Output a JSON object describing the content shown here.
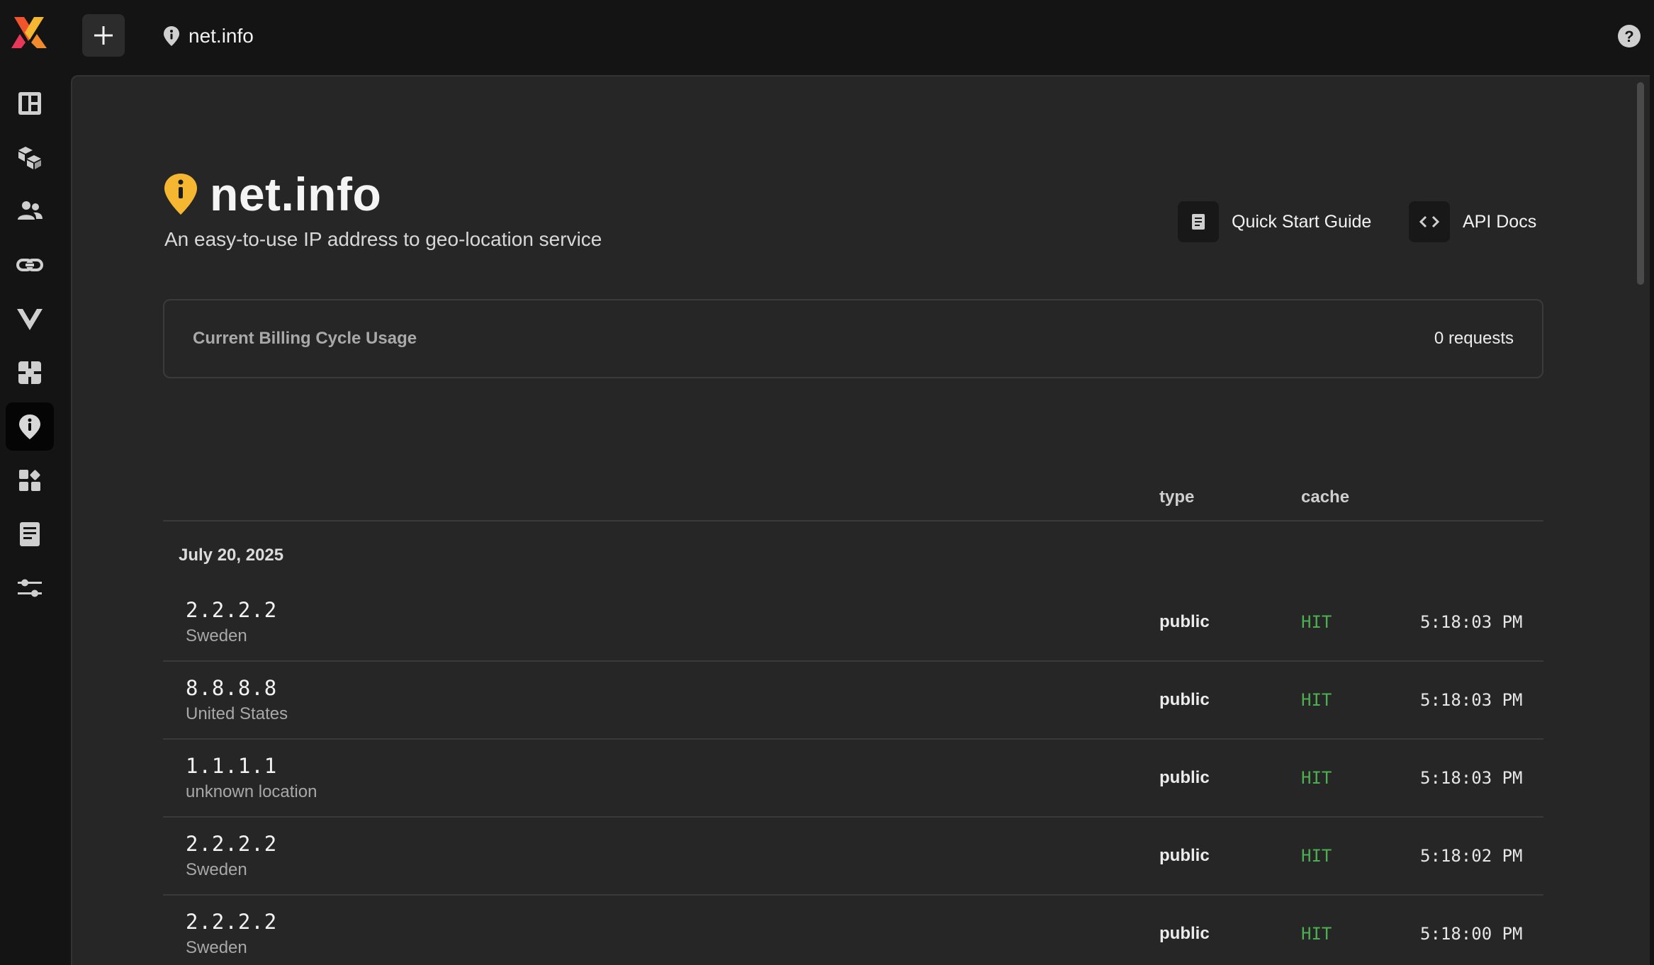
{
  "topbar": {
    "app_logo": "multicolor-logo",
    "new_button_icon": "plus-icon",
    "breadcrumb": {
      "icon": "info-pin-icon",
      "label": "net.info"
    },
    "help_icon": "help-icon"
  },
  "sidebar": {
    "items": [
      {
        "icon": "dashboard-icon",
        "active": false
      },
      {
        "icon": "boxes-icon",
        "active": false
      },
      {
        "icon": "users-icon",
        "active": false
      },
      {
        "icon": "link-icon",
        "active": false
      },
      {
        "icon": "vue-icon",
        "active": false
      },
      {
        "icon": "puzzle-icon",
        "active": false
      },
      {
        "icon": "info-pin-icon",
        "active": true
      },
      {
        "icon": "apps-icon",
        "active": false
      },
      {
        "icon": "document-icon",
        "active": false
      },
      {
        "icon": "sliders-icon",
        "active": false
      }
    ]
  },
  "header": {
    "title": "net.info",
    "subtitle": "An easy-to-use IP address to geo-location service",
    "title_icon_color": "#f5b731",
    "actions": [
      {
        "label": "Quick Start Guide",
        "icon": "document-icon"
      },
      {
        "label": "API Docs",
        "icon": "code-icon"
      }
    ]
  },
  "usage": {
    "label": "Current Billing Cycle Usage",
    "value": "0 requests"
  },
  "table": {
    "columns": {
      "type": "type",
      "cache": "cache"
    },
    "date_group": "July 20, 2025",
    "rows": [
      {
        "ip": "2.2.2.2",
        "location": "Sweden",
        "type": "public",
        "cache": "HIT",
        "time": "5:18:03 PM"
      },
      {
        "ip": "8.8.8.8",
        "location": "United States",
        "type": "public",
        "cache": "HIT",
        "time": "5:18:03 PM"
      },
      {
        "ip": "1.1.1.1",
        "location": "unknown location",
        "type": "public",
        "cache": "HIT",
        "time": "5:18:03 PM"
      },
      {
        "ip": "2.2.2.2",
        "location": "Sweden",
        "type": "public",
        "cache": "HIT",
        "time": "5:18:02 PM"
      },
      {
        "ip": "2.2.2.2",
        "location": "Sweden",
        "type": "public",
        "cache": "HIT",
        "time": "5:18:00 PM"
      }
    ]
  },
  "colors": {
    "accent": "#f5b731",
    "cache_hit": "#4caf50",
    "panel_bg": "#262626",
    "app_bg": "#141414"
  }
}
